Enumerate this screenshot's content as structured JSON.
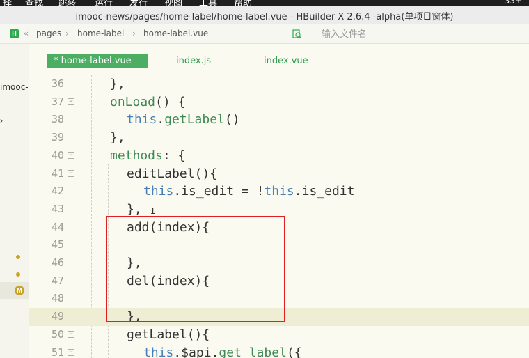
{
  "menubar": {
    "items": [
      "择",
      "查找",
      "跳转",
      "运行",
      "发行",
      "视图",
      "工具",
      "帮助"
    ],
    "status": "33+"
  },
  "window": {
    "title": "imooc-news/pages/home-label/home-label.vue - HBuilder X 2.6.4 -alpha(单项目窗体)"
  },
  "toolbar": {
    "logo": "H",
    "crumb_prefix": "«",
    "crumbs": [
      "pages",
      "home-label",
      "home-label.vue"
    ],
    "file_placeholder": "输入文件名"
  },
  "sidebar": {
    "project": "imooc-r",
    "modified_badge": "M"
  },
  "tabs": [
    {
      "label": "* home-label.vue",
      "active": true
    },
    {
      "label": "index.js",
      "active": false
    },
    {
      "label": "index.vue",
      "active": false
    }
  ],
  "editor": {
    "lines": [
      {
        "n": "36",
        "fold": false
      },
      {
        "n": "37",
        "fold": true
      },
      {
        "n": "38",
        "fold": false
      },
      {
        "n": "39",
        "fold": false
      },
      {
        "n": "40",
        "fold": true
      },
      {
        "n": "41",
        "fold": true
      },
      {
        "n": "42",
        "fold": false
      },
      {
        "n": "43",
        "fold": false
      },
      {
        "n": "44",
        "fold": false
      },
      {
        "n": "45",
        "fold": false
      },
      {
        "n": "46",
        "fold": false
      },
      {
        "n": "47",
        "fold": false
      },
      {
        "n": "48",
        "fold": false
      },
      {
        "n": "49",
        "fold": false
      },
      {
        "n": "50",
        "fold": true
      },
      {
        "n": "51",
        "fold": true
      }
    ],
    "code": {
      "l36": "},",
      "l37_fn": "onLoad",
      "l37_rest": "() {",
      "l38_kw": "this",
      "l38_dot": ".",
      "l38_fn": "getLabel",
      "l38_rest": "()",
      "l39": "},",
      "l40_fn": "methods",
      "l40_rest": ": {",
      "l41": "editLabel(){",
      "l42_kw1": "this",
      "l42_mid": ".is_edit = !",
      "l42_kw2": "this",
      "l42_end": ".is_edit",
      "l43": "},",
      "l44": "add(index){",
      "l45": "",
      "l46": "},",
      "l47": "del(index){",
      "l48": "",
      "l49": "},",
      "l50": "getLabel(){",
      "l51_kw": "this",
      "l51_mid": ".$api.",
      "l51_fn": "get_label",
      "l51_end": "({"
    }
  }
}
